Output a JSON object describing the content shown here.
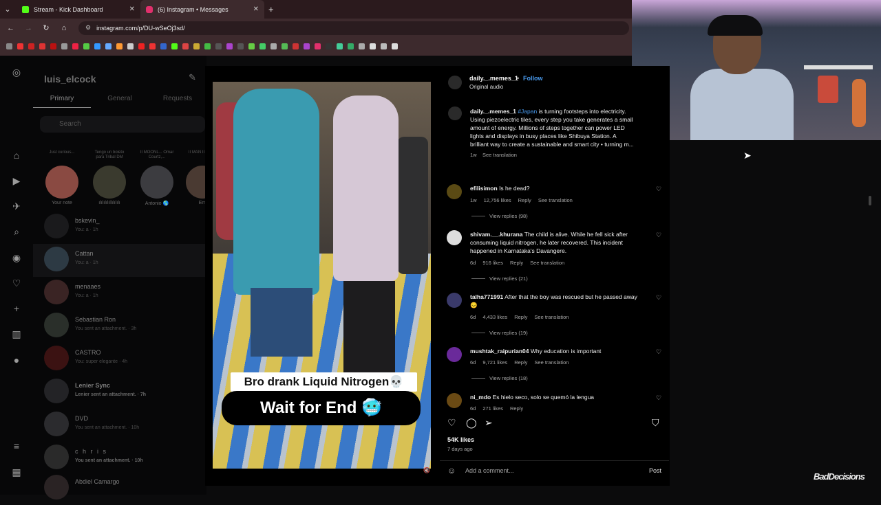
{
  "browser": {
    "tabs": [
      {
        "title": "Stream - Kick Dashboard",
        "color": "#53fc18"
      },
      {
        "title": "(6) Instagram • Messages",
        "color": "#e1306c"
      }
    ],
    "new_tab": "+",
    "url": "instagram.com/p/DU-wSeOj3sd/"
  },
  "dm": {
    "username": "luis_elcock",
    "tabs": [
      "Primary",
      "General",
      "Requests"
    ],
    "search_placeholder": "Search",
    "notes": [
      {
        "bubble": "Just curious...",
        "name": "Your note"
      },
      {
        "bubble": "Tengo un boleto para Tribal DM",
        "name": "ılılılılıllılılılı"
      },
      {
        "bubble": "II MOONL... Omar Courtz,...",
        "name": "Antonio 🌎"
      },
      {
        "bubble": "II MAN II Amen",
        "name": "Em"
      }
    ],
    "conversations": [
      {
        "name": "bskevin_",
        "sub": "You: a · 1h"
      },
      {
        "name": "Cattan",
        "sub": "You: a · 1h"
      },
      {
        "name": "menaaes",
        "sub": "You: a · 1h"
      },
      {
        "name": "Sebastian Ron",
        "sub": "You sent an attachment. · 3h"
      },
      {
        "name": "CASTRO",
        "sub": "You: super elegante · 4h"
      },
      {
        "name": "Lenier Sync",
        "sub": "Lenier sent an attachment. · 7h"
      },
      {
        "name": "DVD",
        "sub": "You sent an attachment. · 10h"
      },
      {
        "name": "c h r i s",
        "sub": "You sent an attachment. · 10h"
      },
      {
        "name": "Abdiel Camargo",
        "sub": ""
      }
    ]
  },
  "video": {
    "caption_top": "Bro drank Liquid Nitrogen💀",
    "caption_bottom": "Wait for End 🥶"
  },
  "post": {
    "author": "daily._.memes_1",
    "separator": "•",
    "follow": "Follow",
    "audio": "Original audio",
    "caption_hashtag": "#Japan",
    "caption_text": "is turning footsteps into electricity. Using piezoelectric tiles, every step you take generates a small amount of energy. Millions of steps together can power LED lights and displays in busy places like Shibuya Station. A brilliant way to create a sustainable and smart city • turning m...",
    "caption_time": "1w",
    "see_translation": "See translation",
    "comments": [
      {
        "user": "efilisimon",
        "text": "Is he dead?",
        "time": "1w",
        "likes": "12,756 likes",
        "replies": "View replies (98)"
      },
      {
        "user": "shivam.__.khurana",
        "text": "The child is alive. While he fell sick after consuming liquid nitrogen, he later recovered. This incident happened in Karnataka's Davangere.",
        "time": "6d",
        "likes": "916 likes",
        "replies": "View replies (21)"
      },
      {
        "user": "talha771991",
        "text": "After that the boy was rescued but he passed away😔",
        "time": "6d",
        "likes": "4,433 likes",
        "replies": "View replies (19)"
      },
      {
        "user": "mushtak_raipurian04",
        "text": "Why education is important",
        "time": "6d",
        "likes": "9,721 likes",
        "replies": "View replies (18)"
      },
      {
        "user": "ni_mdo",
        "text": "Es hielo seco, solo se quemó la lengua",
        "time": "6d",
        "likes": "271 likes",
        "replies": ""
      }
    ],
    "reply_label": "Reply",
    "likes_total": "54K likes",
    "posted_ago": "7 days ago",
    "add_comment_placeholder": "Add a comment...",
    "post_button": "Post"
  },
  "overlay": {
    "brand": "BadDecisions"
  }
}
